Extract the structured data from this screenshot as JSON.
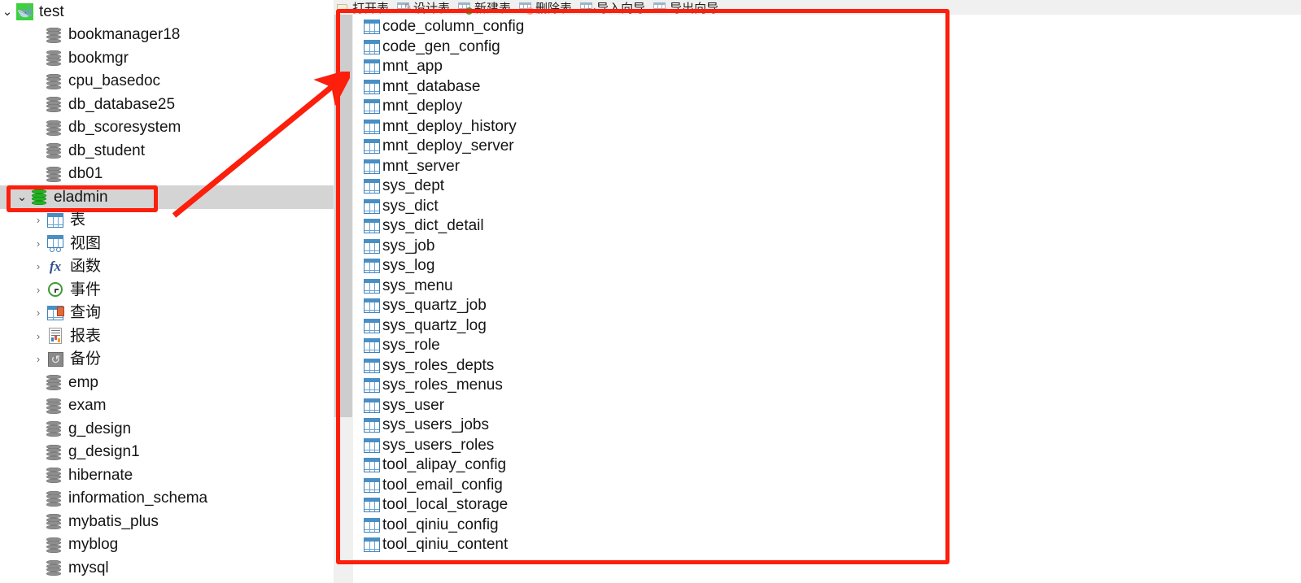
{
  "toolbar": {
    "buttons": [
      {
        "label": "打开表",
        "icon": "open-table-icon"
      },
      {
        "label": "设计表",
        "icon": "design-table-icon"
      },
      {
        "label": "新建表",
        "icon": "new-table-icon"
      },
      {
        "label": "删除表",
        "icon": "delete-table-icon"
      },
      {
        "label": "导入向导",
        "icon": "import-wizard-icon"
      },
      {
        "label": "导出向导",
        "icon": "export-wizard-icon"
      }
    ]
  },
  "tree": {
    "root": {
      "label": "test",
      "icon": "mysql-connection-icon",
      "expanded": true,
      "chevron": "⌄"
    },
    "databases": [
      {
        "label": "bookmanager18",
        "icon": "database-icon",
        "state": "normal"
      },
      {
        "label": "bookmgr",
        "icon": "database-icon",
        "state": "normal"
      },
      {
        "label": "cpu_basedoc",
        "icon": "database-icon",
        "state": "normal"
      },
      {
        "label": "db_database25",
        "icon": "database-icon",
        "state": "normal"
      },
      {
        "label": "db_scoresystem",
        "icon": "database-icon",
        "state": "normal"
      },
      {
        "label": "db_student",
        "icon": "database-icon",
        "state": "normal"
      },
      {
        "label": "db01",
        "icon": "database-icon",
        "state": "normal"
      },
      {
        "label": "eladmin",
        "icon": "database-open-icon",
        "state": "selected",
        "expanded": true
      },
      {
        "label": "emp",
        "icon": "database-icon",
        "state": "normal"
      },
      {
        "label": "exam",
        "icon": "database-icon",
        "state": "normal"
      },
      {
        "label": "g_design",
        "icon": "database-icon",
        "state": "normal"
      },
      {
        "label": "g_design1",
        "icon": "database-icon",
        "state": "normal"
      },
      {
        "label": "hibernate",
        "icon": "database-icon",
        "state": "normal"
      },
      {
        "label": "information_schema",
        "icon": "database-icon",
        "state": "normal"
      },
      {
        "label": "mybatis_plus",
        "icon": "database-icon",
        "state": "normal"
      },
      {
        "label": "myblog",
        "icon": "database-icon",
        "state": "normal"
      },
      {
        "label": "mysql",
        "icon": "database-icon",
        "state": "normal"
      }
    ],
    "eladmin_children": [
      {
        "label": "表",
        "icon": "tables-icon"
      },
      {
        "label": "视图",
        "icon": "views-icon"
      },
      {
        "label": "函数",
        "icon": "functions-icon"
      },
      {
        "label": "事件",
        "icon": "events-icon"
      },
      {
        "label": "查询",
        "icon": "queries-icon"
      },
      {
        "label": "报表",
        "icon": "reports-icon"
      },
      {
        "label": "备份",
        "icon": "backups-icon"
      }
    ]
  },
  "table_list": {
    "icon": "table-icon",
    "items": [
      "code_column_config",
      "code_gen_config",
      "mnt_app",
      "mnt_database",
      "mnt_deploy",
      "mnt_deploy_history",
      "mnt_deploy_server",
      "mnt_server",
      "sys_dept",
      "sys_dict",
      "sys_dict_detail",
      "sys_job",
      "sys_log",
      "sys_menu",
      "sys_quartz_job",
      "sys_quartz_log",
      "sys_role",
      "sys_roles_depts",
      "sys_roles_menus",
      "sys_user",
      "sys_users_jobs",
      "sys_users_roles",
      "tool_alipay_config",
      "tool_email_config",
      "tool_local_storage",
      "tool_qiniu_config",
      "tool_qiniu_content"
    ]
  },
  "annotations": {
    "color": "#fb1f0c",
    "highlight_database": "eladmin",
    "highlight_region": "table-list",
    "arrow": "points from eladmin database node to table list panel"
  }
}
